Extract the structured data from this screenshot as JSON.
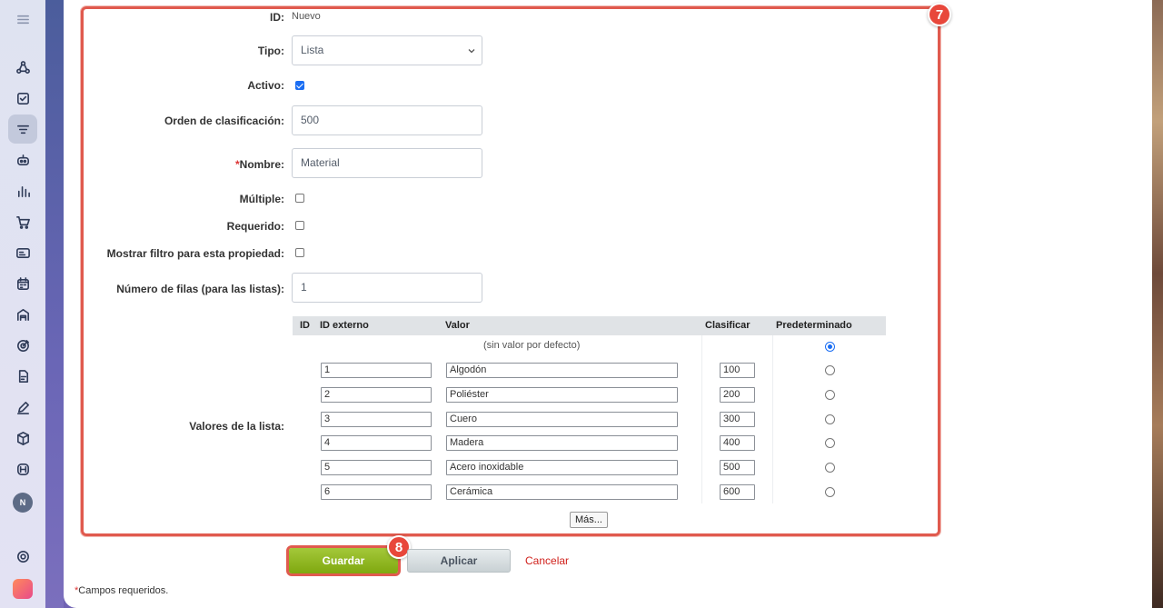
{
  "colors": {
    "accent": "#e05a4e",
    "primary_button": "#8bb31e",
    "link_cancel": "#d0211c",
    "checkbox_blue": "#1b6ef3"
  },
  "nav": {
    "icons": [
      "menu-icon",
      "crm-icon",
      "tasks-icon",
      "sales-funnel-icon",
      "robot-icon",
      "analytics-icon",
      "cart-icon",
      "contact-card-icon",
      "calendar-icon",
      "warehouse-icon",
      "goals-icon",
      "documents-icon",
      "sign-icon",
      "inventory-box-icon",
      "support-icon",
      "settings-icon",
      "marketplace-icon"
    ],
    "avatar_initial": "N"
  },
  "form": {
    "id_label": "ID:",
    "id_value": "Nuevo",
    "type_label": "Tipo:",
    "type_value": "Lista",
    "active_label": "Activo:",
    "active_checked": true,
    "sort_label": "Orden de clasificación:",
    "sort_value": "500",
    "name_required_mark": "*",
    "name_label": "Nombre:",
    "name_value": "Material",
    "multiple_label": "Múltiple:",
    "multiple_checked": false,
    "required_label": "Requerido:",
    "required_checked": false,
    "filter_label": "Mostrar filtro para esta propiedad:",
    "filter_checked": false,
    "rows_label": "Número de filas (para las listas):",
    "rows_value": "1",
    "list_values_label": "Valores de la lista:"
  },
  "list_table": {
    "headers": [
      "ID",
      "ID externo",
      "Valor",
      "Clasificar",
      "Predeterminado"
    ],
    "default_row_text": "(sin valor por defecto)",
    "default_selected": true,
    "rows": [
      {
        "ext_id": "1",
        "value": "Algodón",
        "sort": "100"
      },
      {
        "ext_id": "2",
        "value": "Poliéster",
        "sort": "200"
      },
      {
        "ext_id": "3",
        "value": "Cuero",
        "sort": "300"
      },
      {
        "ext_id": "4",
        "value": "Madera",
        "sort": "400"
      },
      {
        "ext_id": "5",
        "value": "Acero inoxidable",
        "sort": "500"
      },
      {
        "ext_id": "6",
        "value": "Cerámica",
        "sort": "600"
      }
    ],
    "more_label": "Más..."
  },
  "actions": {
    "save_label": "Guardar",
    "apply_label": "Aplicar",
    "cancel_label": "Cancelar"
  },
  "footnote": {
    "mark": "*",
    "text": "Campos requeridos."
  },
  "badges": {
    "frame_step": "7",
    "save_step": "8"
  }
}
